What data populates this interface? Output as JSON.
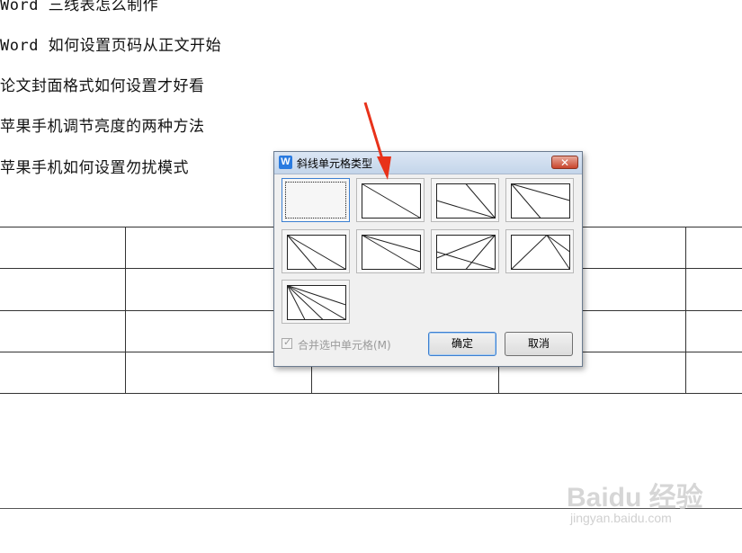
{
  "document": {
    "lines": [
      "Word 三线表怎么制作",
      "Word 如何设置页码从正文开始",
      "论文封面格式如何设置才好看",
      "苹果手机调节亮度的两种方法",
      "苹果手机如何设置勿扰模式"
    ]
  },
  "dialog": {
    "app_icon": "W",
    "title": "斜线单元格类型",
    "close_symbol": "✕",
    "tiles": [
      {
        "name": "none"
      },
      {
        "name": "single-diagonal"
      },
      {
        "name": "two-lines-from-top-left-variant"
      },
      {
        "name": "two-lines-from-top-left"
      },
      {
        "name": "two-lines-from-top-left-alt"
      },
      {
        "name": "two-lines-to-right-edge"
      },
      {
        "name": "three-lines-mixed"
      },
      {
        "name": "three-lines-from-top-corner"
      },
      {
        "name": "fan-four-lines"
      }
    ],
    "merge_checkbox_label": "合并选中单元格(M)",
    "merge_checked": true,
    "ok_label": "确定",
    "cancel_label": "取消"
  },
  "annotation": {
    "arrow_color": "#e8321a"
  },
  "watermark": {
    "logo": "Baidu 经验",
    "url": "jingyan.baidu.com"
  }
}
